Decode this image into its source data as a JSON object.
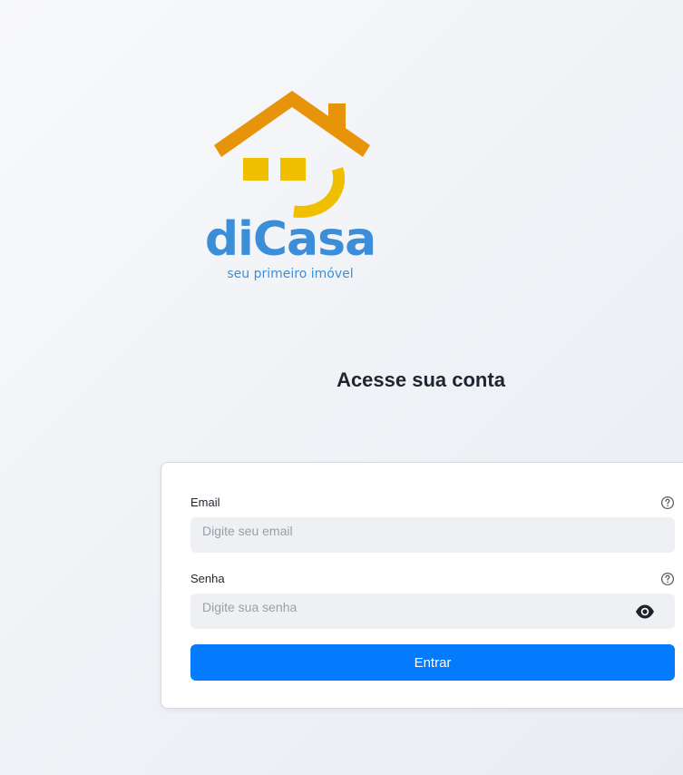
{
  "brand": {
    "name": "diCasa",
    "tagline": "seu primeiro imóvel",
    "colors": {
      "roof": "#e8940a",
      "accent": "#f0c000",
      "text": "#3d8ed8"
    }
  },
  "page_title": "Acesse sua conta",
  "form": {
    "email": {
      "label": "Email",
      "placeholder": "Digite seu email",
      "value": "",
      "help_icon": "question-circle-icon"
    },
    "password": {
      "label": "Senha",
      "placeholder": "Digite sua senha",
      "value": "",
      "help_icon": "question-circle-icon",
      "toggle_icon": "eye-icon"
    },
    "submit_label": "Entrar"
  },
  "colors": {
    "primary": "#037bfc",
    "input_bg": "#eff0f4",
    "card_border": "#d6d9de"
  }
}
